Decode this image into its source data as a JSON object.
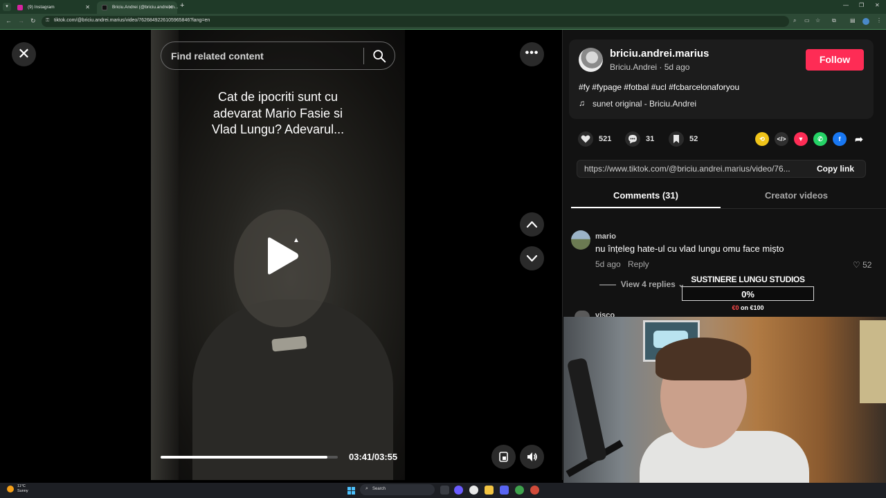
{
  "browser": {
    "tabs": [
      {
        "title": "(9) Instagram",
        "color": "#d6249f"
      },
      {
        "title": "Briciu.Andrei (@briciu.andrei.m...",
        "color": "#111111"
      }
    ],
    "url": "tiktok.com/@briciu.andrei.marius/video/7626849226105965846?lang=en"
  },
  "video": {
    "search_placeholder": "Find related content",
    "caption": "Cat de ipocriti sunt cu adevarat Mario Fasie si Vlad Lungu? Adevarul...",
    "timecode": "03:41/03:55",
    "progress_fraction": 0.94
  },
  "author": {
    "username": "briciu.andrei.marius",
    "display_name": "Briciu.Andrei",
    "posted": "5d ago",
    "follow_label": "Follow",
    "description": "#fy #fypage #fotbal #ucl #fcbarcelonaforyou",
    "music": "sunet original - Briciu.Andrei"
  },
  "stats": {
    "likes": "521",
    "comments": "31",
    "saves": "52"
  },
  "share": {
    "url": "https://www.tiktok.com/@briciu.andrei.marius/video/76...",
    "copy_label": "Copy link"
  },
  "tabs": {
    "comments": "Comments (31)",
    "creator": "Creator videos"
  },
  "comments": [
    {
      "user": "mario",
      "text": "nu înțeleg hate-ul cu vlad lungu omu face mișto",
      "age": "5d ago",
      "reply_label": "Reply",
      "likes": "52",
      "view_replies": "View 4 replies"
    },
    {
      "user": "visco"
    }
  ],
  "donation": {
    "title": "SUSTINERE LUNGU STUDIOS",
    "percent": "0%",
    "raised": "€0",
    "goal": "on €100"
  },
  "taskbar": {
    "temp": "11°C",
    "weather": "Sunny",
    "search": "Search"
  },
  "colors": {
    "accent": "#fe2c55",
    "panel_bg": "#121212"
  }
}
